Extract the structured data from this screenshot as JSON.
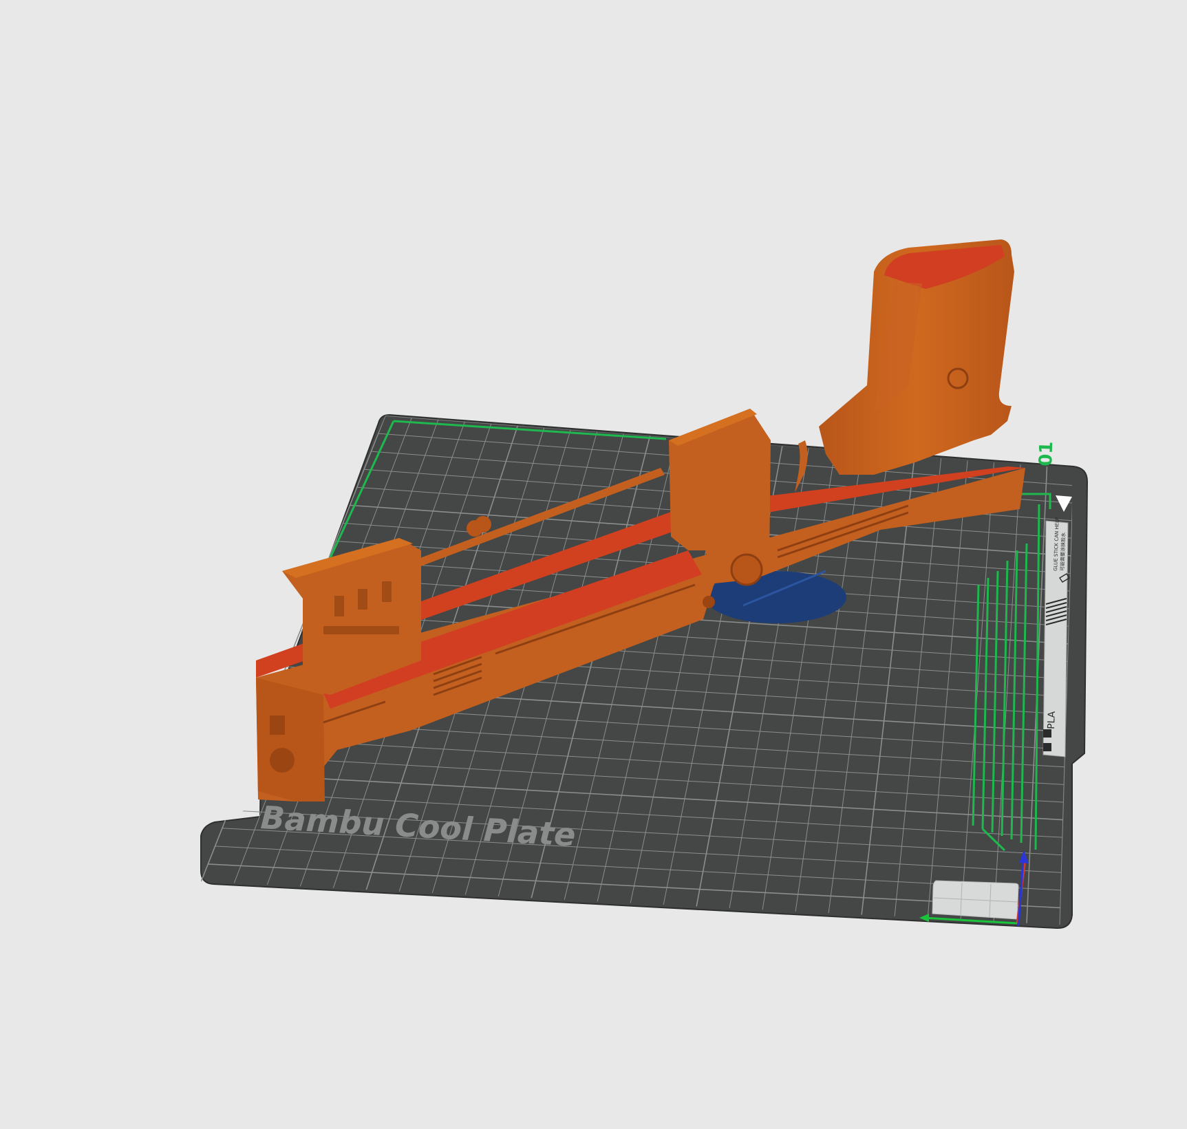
{
  "viewport": {
    "background": "#e8e8e8"
  },
  "plate": {
    "label": "Bambu Cool Plate",
    "index": "01",
    "sticker_material": "PLA",
    "sticker_note": "GLUE STICK CAN HELP",
    "sticker_note_cn": "可能需要涂抹胶水",
    "bed_color": "#444746",
    "grid_color": "#8b8e8d",
    "border_accent": "#1fb84e"
  },
  "model": {
    "color": "#c4601f",
    "top_color": "#d1401f",
    "shadow_color": "#8e3f12"
  },
  "axes": {
    "x_color": "#d23a2a",
    "y_color": "#19c43a",
    "z_color": "#2a36d8"
  },
  "icons": {
    "sticker_logo": "bambu-logo-icon",
    "sticker_qr": "qr-code-icon",
    "sticker_eraser": "eraser-icon"
  }
}
